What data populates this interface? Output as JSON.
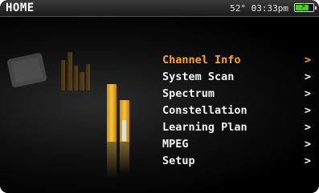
{
  "header": {
    "title": "HOME",
    "status_text": "52° 03:33pm",
    "battery": {
      "level": 0.75,
      "charging": true,
      "color": "#3cd21e"
    }
  },
  "menu": {
    "active_color": "#f5a623",
    "items": [
      {
        "label": "Channel Info",
        "arrow": ">"
      },
      {
        "label": "System Scan",
        "arrow": ">"
      },
      {
        "label": "Spectrum",
        "arrow": ">"
      },
      {
        "label": "Constellation",
        "arrow": ">"
      },
      {
        "label": "Learning Plan",
        "arrow": ">"
      },
      {
        "label": "MPEG",
        "arrow": ">"
      },
      {
        "label": "Setup",
        "arrow": ">"
      }
    ]
  }
}
